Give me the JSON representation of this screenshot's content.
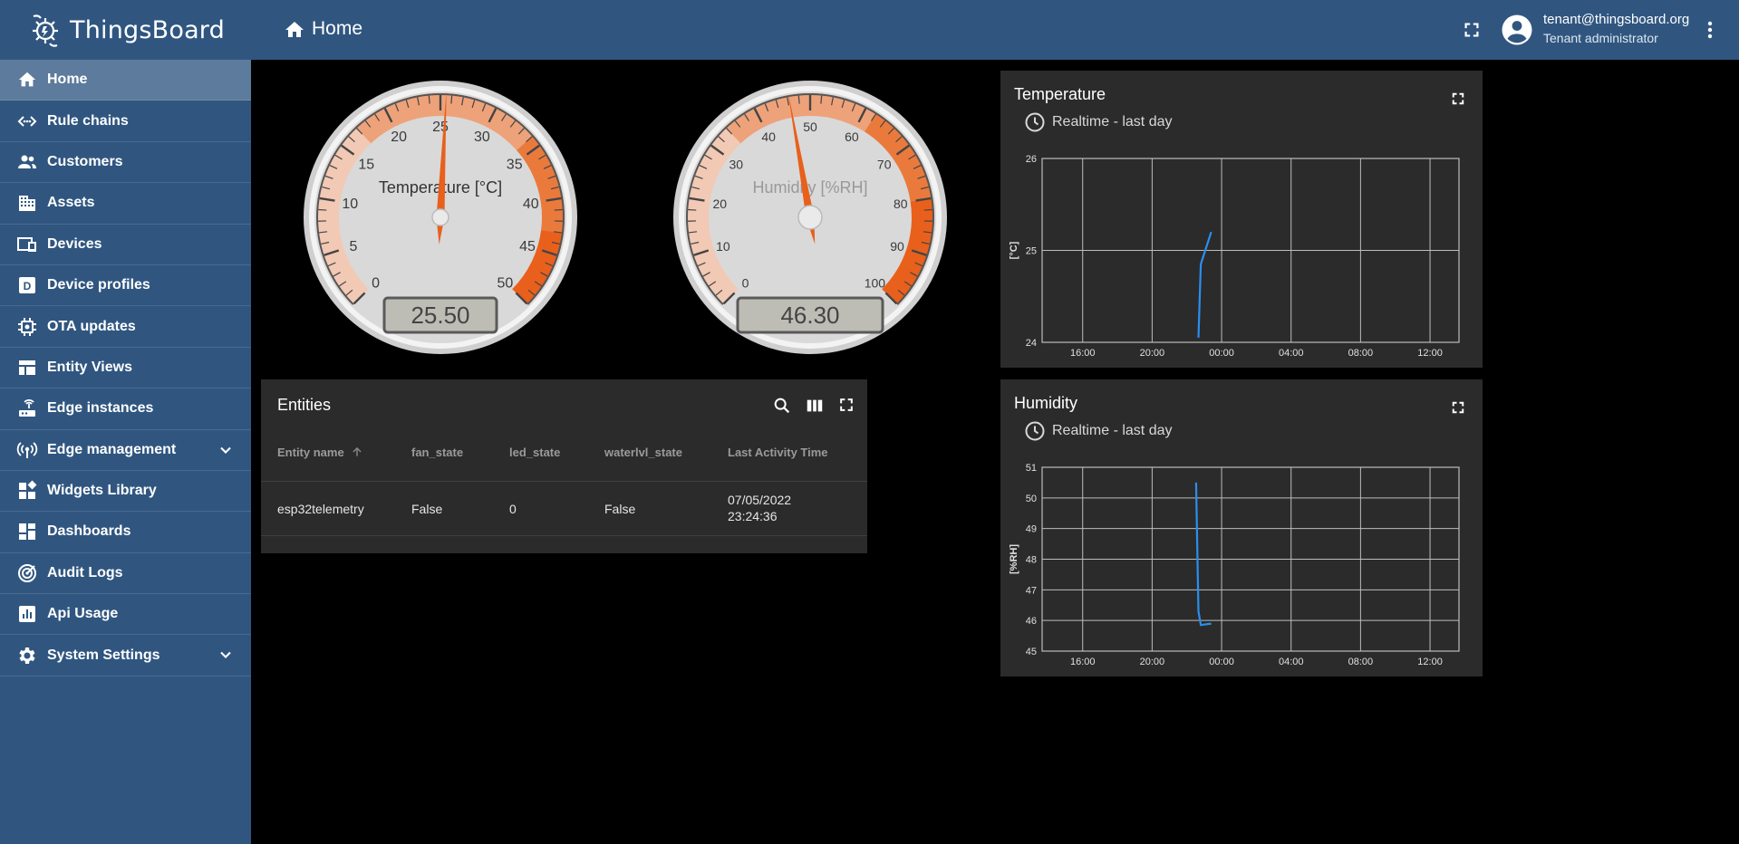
{
  "app": {
    "name": "ThingsBoard"
  },
  "sidebar": {
    "items": [
      {
        "label": "Home",
        "icon": "home-icon",
        "active": true
      },
      {
        "label": "Rule chains",
        "icon": "rule-chain-icon"
      },
      {
        "label": "Customers",
        "icon": "customers-icon"
      },
      {
        "label": "Assets",
        "icon": "assets-icon"
      },
      {
        "label": "Devices",
        "icon": "devices-icon"
      },
      {
        "label": "Device profiles",
        "icon": "device-profile-icon"
      },
      {
        "label": "OTA updates",
        "icon": "ota-icon"
      },
      {
        "label": "Entity Views",
        "icon": "entity-views-icon"
      },
      {
        "label": "Edge instances",
        "icon": "edge-icon"
      },
      {
        "label": "Edge management",
        "icon": "edge-management-icon",
        "expandable": true
      },
      {
        "label": "Widgets Library",
        "icon": "widgets-icon"
      },
      {
        "label": "Dashboards",
        "icon": "dashboards-icon"
      },
      {
        "label": "Audit Logs",
        "icon": "audit-logs-icon"
      },
      {
        "label": "Api Usage",
        "icon": "api-usage-icon"
      },
      {
        "label": "System Settings",
        "icon": "settings-icon",
        "expandable": true
      }
    ]
  },
  "header": {
    "title": "Home",
    "user_email": "tenant@thingsboard.org",
    "user_role": "Tenant administrator"
  },
  "gauges": {
    "temperature": {
      "label": "Temperature [°C]",
      "value": 25.5,
      "display": "25.50",
      "min": 0,
      "max": 50,
      "ticks": [
        "0",
        "5",
        "10",
        "15",
        "20",
        "25",
        "30",
        "35",
        "40",
        "45",
        "50"
      ]
    },
    "humidity": {
      "label": "Humidity [%RH]",
      "value": 46.3,
      "display": "46.30",
      "min": 0,
      "max": 100,
      "ticks": [
        "0",
        "10",
        "20",
        "30",
        "40",
        "50",
        "60",
        "70",
        "80",
        "90",
        "100"
      ]
    }
  },
  "entities": {
    "title": "Entities",
    "columns": [
      "Entity name",
      "fan_state",
      "led_state",
      "waterlvl_state",
      "Last Activity Time"
    ],
    "rows": [
      {
        "name": "esp32telemetry",
        "fan_state": "False",
        "led_state": "0",
        "waterlvl_state": "False",
        "time_line1": "07/05/2022",
        "time_line2": "23:24:36"
      }
    ]
  },
  "charts": {
    "temperature": {
      "title": "Temperature",
      "subtitle": "Realtime - last day"
    },
    "humidity": {
      "title": "Humidity",
      "subtitle": "Realtime - last day"
    }
  },
  "colors": {
    "sidebar": "#305680",
    "accent": "#e8601c",
    "series": "#2a8ff0"
  },
  "chart_data": [
    {
      "type": "line",
      "title": "Temperature",
      "ylabel": "[°C]",
      "ylim": [
        24,
        26
      ],
      "y_ticks": [
        "24",
        "25",
        "26"
      ],
      "x_ticks": [
        "16:00",
        "20:00",
        "00:00",
        "04:00",
        "08:00",
        "12:00"
      ],
      "series": [
        {
          "values": [
            {
              "x": "22:40",
              "y": 24.05
            },
            {
              "x": "22:48",
              "y": 24.85
            },
            {
              "x": "23:24",
              "y": 25.2
            }
          ]
        }
      ]
    },
    {
      "type": "line",
      "title": "Humidity",
      "ylabel": "[%RH]",
      "ylim": [
        45,
        51
      ],
      "y_ticks": [
        "45",
        "46",
        "47",
        "48",
        "49",
        "50",
        "51"
      ],
      "x_ticks": [
        "16:00",
        "20:00",
        "00:00",
        "04:00",
        "08:00",
        "12:00"
      ],
      "series": [
        {
          "values": [
            {
              "x": "22:32",
              "y": 50.5
            },
            {
              "x": "22:40",
              "y": 46.3
            },
            {
              "x": "22:48",
              "y": 45.85
            },
            {
              "x": "23:24",
              "y": 45.9
            }
          ]
        }
      ]
    }
  ]
}
